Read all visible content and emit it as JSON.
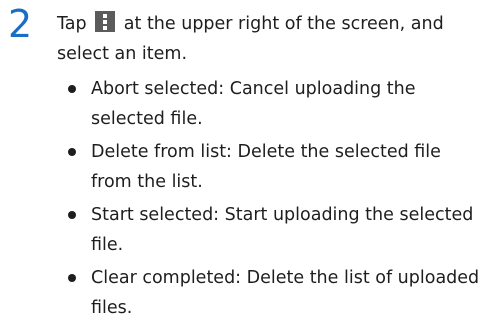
{
  "step": {
    "number": "2",
    "text_before_icon": "Tap",
    "icon": "more-vert-icon",
    "text_after_icon": "at the upper right of the screen, and select an item."
  },
  "items": [
    "Abort selected: Cancel uploading the selected file.",
    "Delete from list: Delete the selected file from the list.",
    "Start selected: Start uploading the selected file.",
    "Clear completed: Delete the list of uploaded files."
  ],
  "colors": {
    "step_number": "#1a6fc4",
    "icon_bg": "#5b5b5b",
    "text": "#1e1e1e"
  }
}
